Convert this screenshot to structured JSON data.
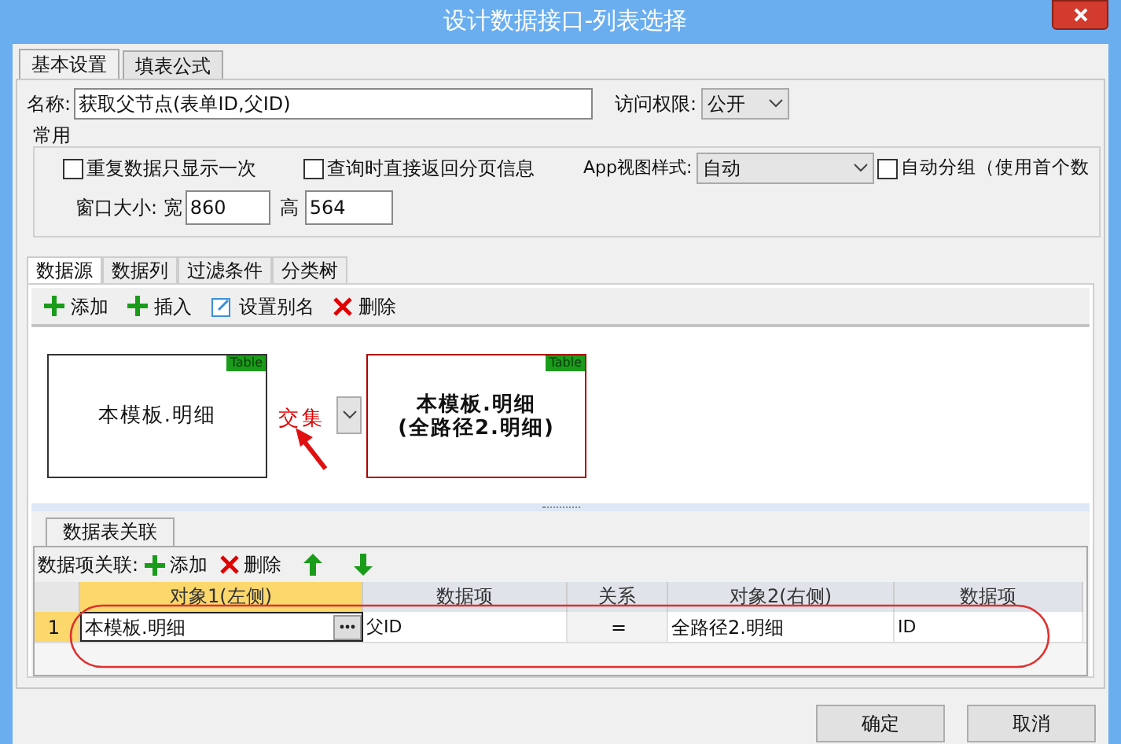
{
  "window": {
    "title": "设计数据接口-列表选择"
  },
  "tabs": [
    {
      "label": "基本设置",
      "selected": true
    },
    {
      "label": "填表公式",
      "selected": false
    }
  ],
  "form": {
    "name_label": "名称:",
    "name_value": "获取父节点(表单ID,父ID)",
    "access_label": "访问权限:",
    "access_value": "公开"
  },
  "common_group": {
    "title": "常用",
    "checkboxes": [
      {
        "label": "重复数据只显示一次",
        "checked": false
      },
      {
        "label": "查询时直接返回分页信息",
        "checked": false
      }
    ],
    "app_view_label": "App视图样式:",
    "app_view_value": "自动",
    "auto_group": {
      "label": "自动分组（使用首个数",
      "checked": false
    },
    "size_label": "窗口大小: 宽",
    "width_value": "860",
    "height_label": "高",
    "height_value": "564"
  },
  "data_tabs": [
    {
      "label": "数据源",
      "selected": true
    },
    {
      "label": "数据列",
      "selected": false
    },
    {
      "label": "过滤条件",
      "selected": false
    },
    {
      "label": "分类树",
      "selected": false
    }
  ],
  "toolbar": [
    {
      "kind": "add",
      "label": "添加"
    },
    {
      "kind": "add",
      "label": "插入"
    },
    {
      "kind": "edit",
      "label": "设置别名"
    },
    {
      "kind": "delete",
      "label": "删除"
    }
  ],
  "diagram": {
    "left_node": {
      "lines": [
        "本模板.明细"
      ],
      "badge": "Table",
      "selected": false
    },
    "join_label": "交集",
    "right_node": {
      "lines": [
        "本模板.明细",
        "(全路径2.明细)"
      ],
      "badge": "Table",
      "selected": true
    }
  },
  "relation_panel": {
    "tab": "数据表关联",
    "toolbar_label": "数据项关联:",
    "toolbar": [
      {
        "kind": "add",
        "label": "添加"
      },
      {
        "kind": "delete",
        "label": "删除"
      },
      {
        "kind": "up"
      },
      {
        "kind": "down"
      }
    ],
    "columns": [
      {
        "label": "对象1(左侧)",
        "selected": true
      },
      {
        "label": "数据项",
        "selected": false
      },
      {
        "label": "关系",
        "selected": false
      },
      {
        "label": "对象2(右侧)",
        "selected": false
      },
      {
        "label": "数据项",
        "selected": false
      }
    ],
    "rows": [
      {
        "number": "1",
        "selected": true,
        "cells": [
          "本模板.明细",
          "父ID",
          "=",
          "全路径2.明细",
          "ID"
        ]
      }
    ]
  },
  "buttons": [
    "确定",
    "取消"
  ]
}
